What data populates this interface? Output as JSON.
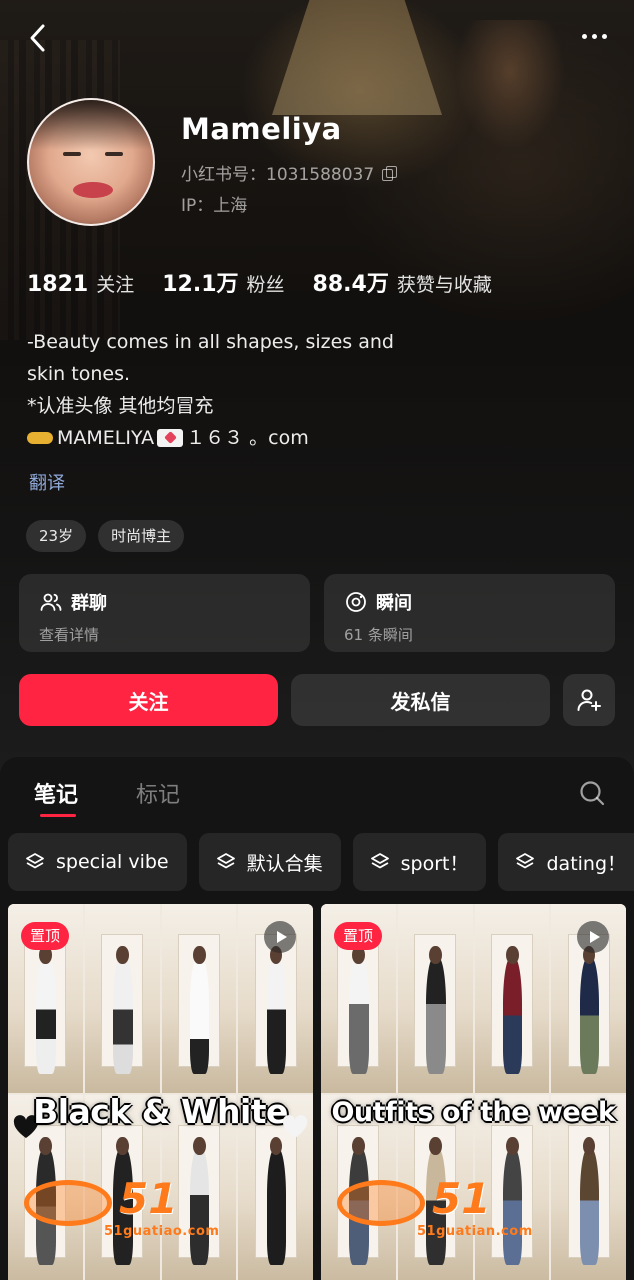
{
  "nav": {
    "back_icon": "back-chevron-icon",
    "more_icon": "more-dots-icon"
  },
  "profile": {
    "name": "Mameliya",
    "red_id": "小红书号：1031588037",
    "ip": "IP：上海"
  },
  "stats": [
    {
      "value": "1821",
      "label": "关注"
    },
    {
      "value": "12.1万",
      "label": "粉丝"
    },
    {
      "value": "88.4万",
      "label": "获赞与收藏"
    }
  ],
  "bio": {
    "line1": "-Beauty comes in all shapes, sizes and",
    "line2": "skin tones.",
    "line3": "*认准头像 其他均冒充",
    "line4_part1": "MAMELIYA",
    "line4_part2": "１６３ 。com"
  },
  "translate_label": "翻译",
  "tags": [
    "23岁",
    "时尚博主"
  ],
  "cards": [
    {
      "title": "群聊",
      "subtitle": "查看详情",
      "icon": "group-people-icon"
    },
    {
      "title": "瞬间",
      "subtitle": "61 条瞬间",
      "icon": "moment-camera-icon"
    }
  ],
  "actions": {
    "follow": "关注",
    "message": "发私信",
    "add_friend_icon": "add-user-icon"
  },
  "tabs": [
    {
      "label": "笔记",
      "active": true
    },
    {
      "label": "标记",
      "active": false
    }
  ],
  "collections": [
    "special vibe",
    "默认合集",
    "sport！",
    "dating！"
  ],
  "notes": [
    {
      "badge": "置顶",
      "title": "Black & White",
      "video": true
    },
    {
      "badge": "置顶",
      "title": "Outfits of the week",
      "video": true
    }
  ],
  "watermarks": [
    {
      "brand": "51",
      "url": "51guatiao.com"
    },
    {
      "brand": "51",
      "url": "51guatian.com"
    }
  ],
  "colors": {
    "accent": "#ff2442",
    "link": "#8fa8d8",
    "watermark": "#ff7a1a"
  }
}
